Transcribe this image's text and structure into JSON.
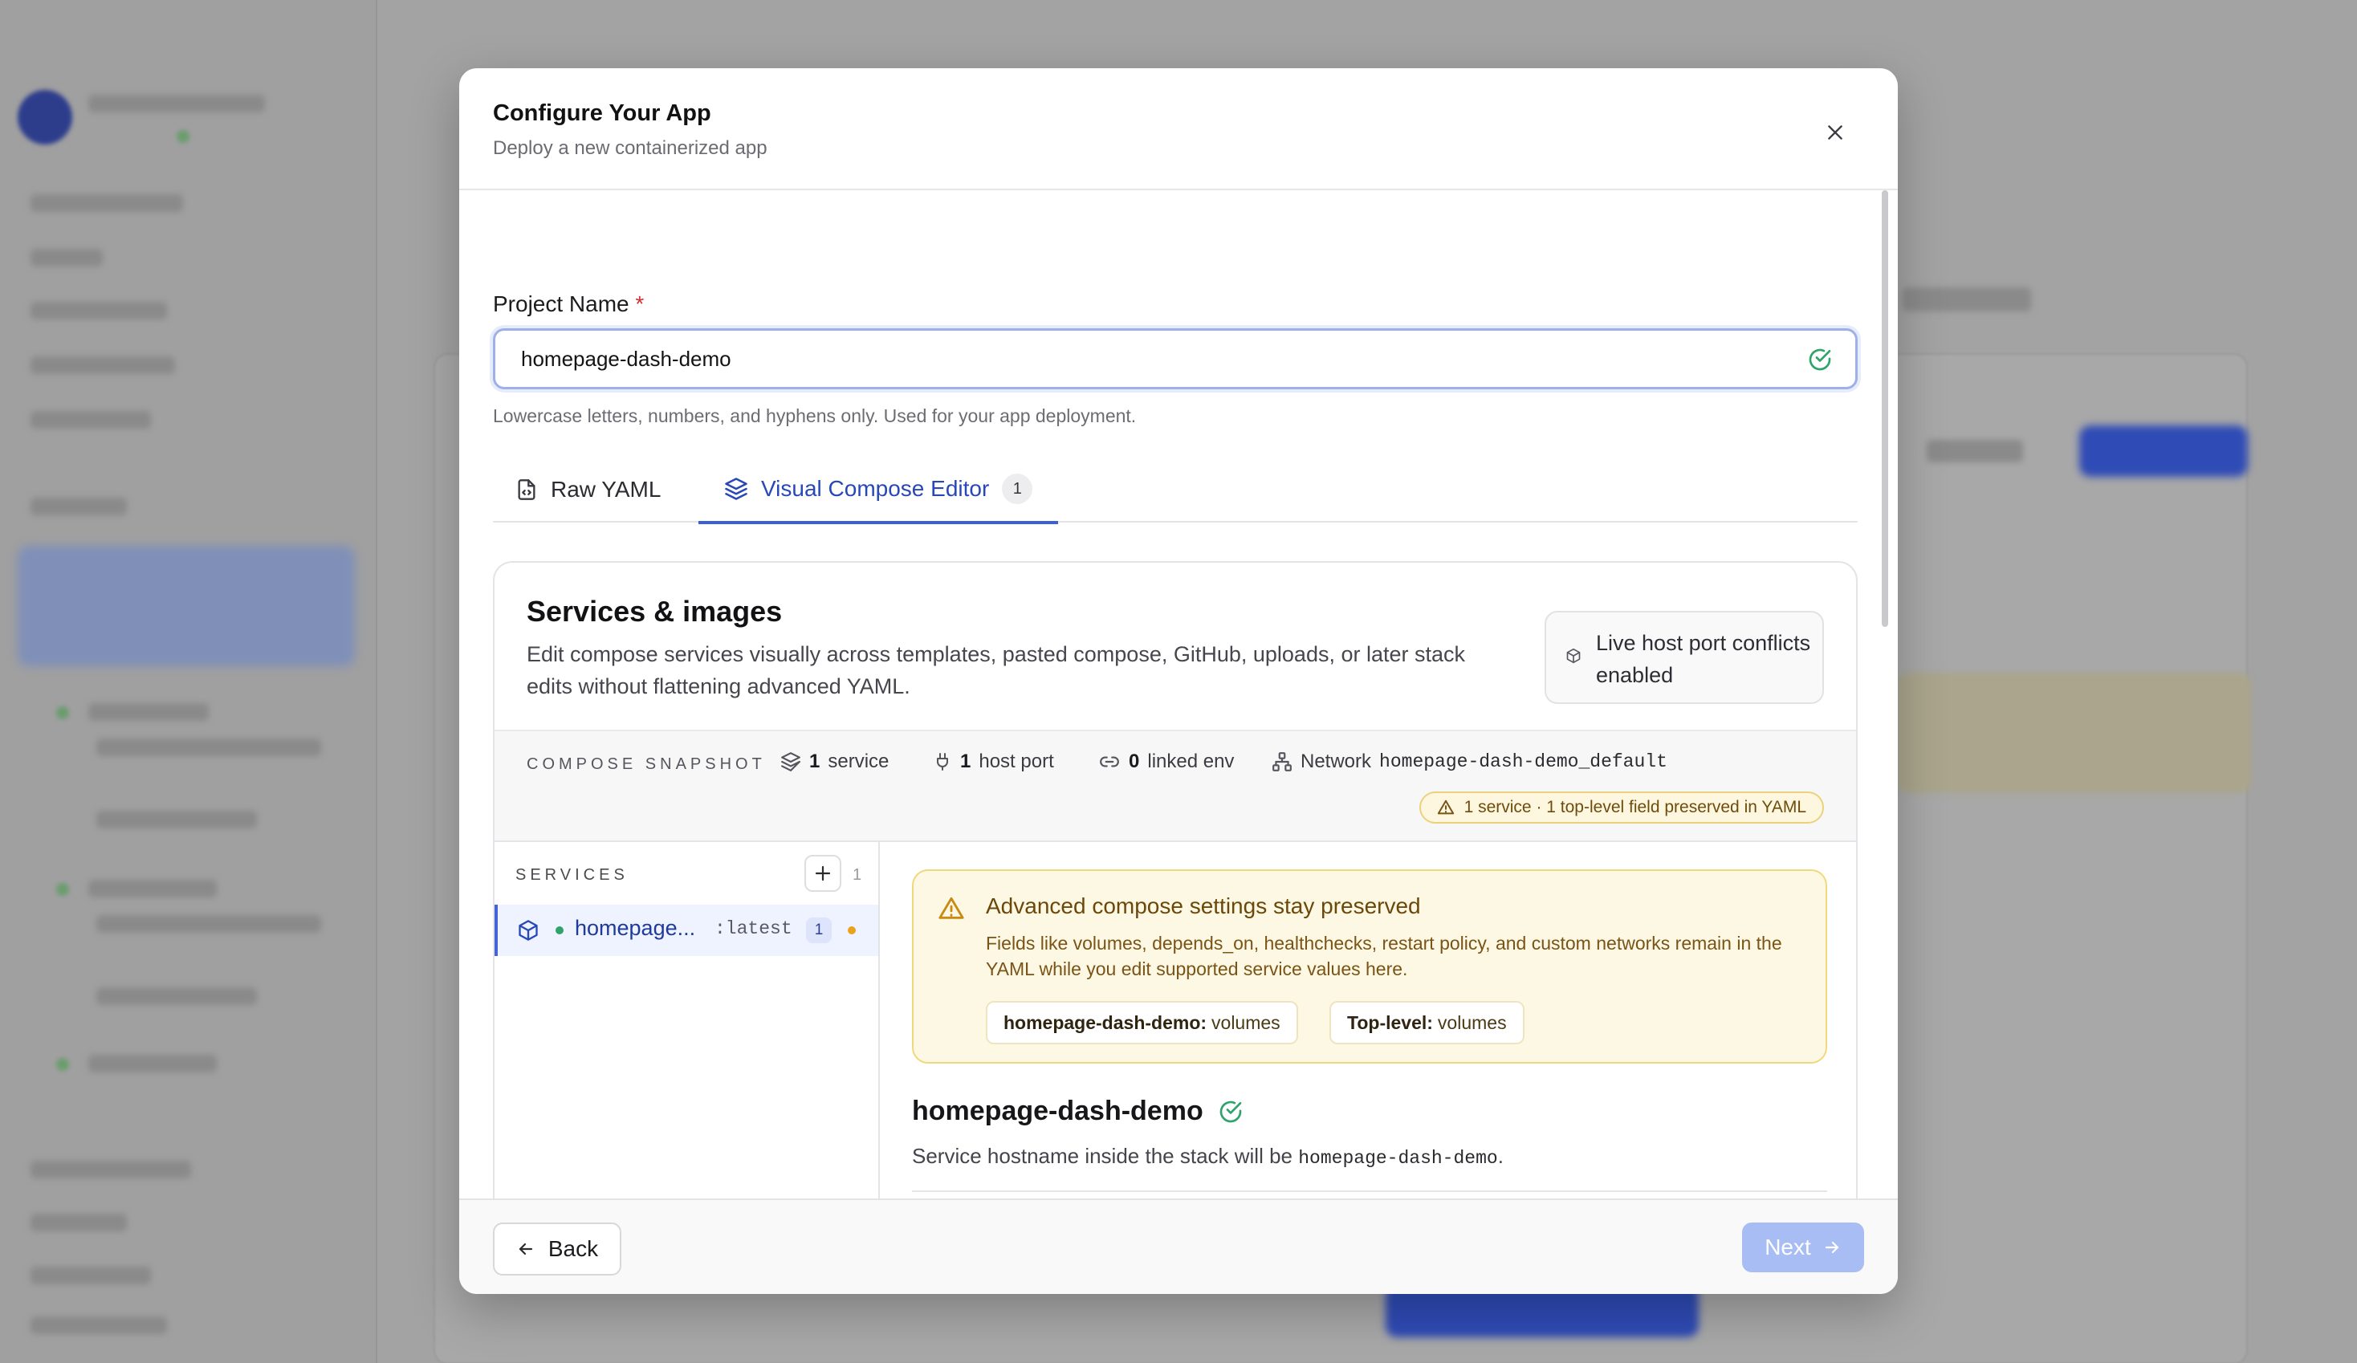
{
  "modal": {
    "title": "Configure Your App",
    "subtitle": "Deploy a new containerized app"
  },
  "project": {
    "label": "Project Name",
    "required_mark": "*",
    "value": "homepage-dash-demo",
    "helper": "Lowercase letters, numbers, and hyphens only. Used for your app deployment."
  },
  "tabs": [
    {
      "label": "Raw YAML",
      "active": false
    },
    {
      "label": "Visual Compose Editor",
      "active": true,
      "badge": "1"
    }
  ],
  "panel": {
    "title": "Services & images",
    "description": "Edit compose services visually across templates, pasted compose, GitHub, uploads, or later stack edits without flattening advanced YAML.",
    "live_box": "Live host port conflicts enabled"
  },
  "snapshot": {
    "label": "COMPOSE SNAPSHOT",
    "services_count": "1",
    "services_label": "service",
    "ports_count": "1",
    "ports_label": "host port",
    "env_count": "0",
    "env_label": "linked env",
    "network_label": "Network",
    "network_name": "homepage-dash-demo_default",
    "warning": "1 service · 1 top-level field preserved in YAML"
  },
  "services": {
    "heading": "SERVICES",
    "count": "1",
    "items": [
      {
        "name": "homepage...",
        "tag": ":latest",
        "badge": "1"
      }
    ]
  },
  "notice": {
    "title": "Advanced compose settings stay preserved",
    "text": "Fields like volumes, depends_on, healthchecks, restart policy, and custom networks remain in the YAML while you edit supported service values here.",
    "chips": [
      {
        "key": "homepage-dash-demo:",
        "value": "volumes"
      },
      {
        "key": "Top-level:",
        "value": "volumes"
      }
    ]
  },
  "service_detail": {
    "name": "homepage-dash-demo",
    "desc_prefix": "Service hostname inside the stack will be",
    "hostname": "homepage-dash-demo",
    "desc_suffix": "."
  },
  "footer": {
    "back_label": "Back",
    "next_label": "Next"
  },
  "colors": {
    "accent": "#3c5fd8",
    "success": "#2ea36a",
    "warning_bg": "#fdf8e3",
    "next_disabled": "#a9bdf5"
  }
}
